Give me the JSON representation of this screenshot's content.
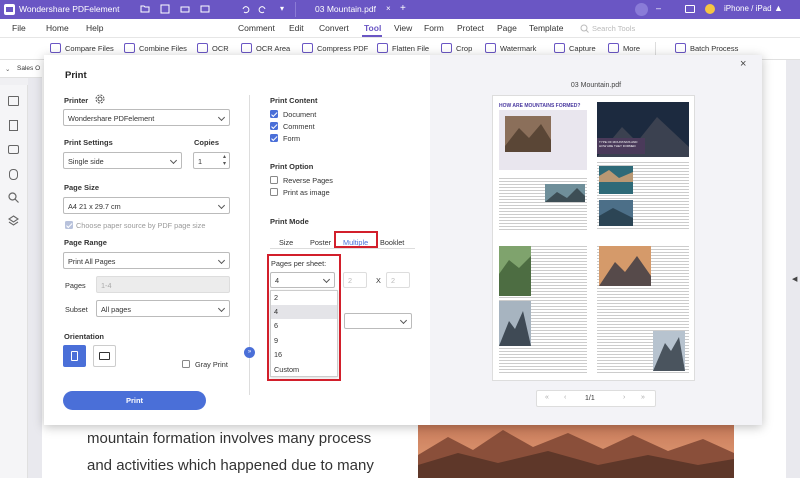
{
  "titlebar": {
    "app_name": "Wondershare PDFelement",
    "file_tab": "03 Mountain.pdf",
    "device_label": "iPhone / iPad"
  },
  "menubar": {
    "items": [
      "File",
      "Home",
      "Help",
      "Comment",
      "Edit",
      "Convert",
      "Tool",
      "View",
      "Form",
      "Protect",
      "Page",
      "Template"
    ],
    "active": "Tool",
    "search_placeholder": "Search Tools"
  },
  "toolbar": {
    "items": [
      "Compare Files",
      "Combine Files",
      "OCR",
      "OCR Area",
      "Compress PDF",
      "Flatten File",
      "Crop",
      "Watermark",
      "Capture",
      "More",
      "Batch Process"
    ]
  },
  "breadcrumb": "Sales O",
  "document": {
    "line1": "mountain formation involves many process",
    "line2": "and activities which happened due to many"
  },
  "dialog": {
    "title": "Print",
    "printer_label": "Printer",
    "printer_value": "Wondershare PDFelement",
    "print_settings_label": "Print Settings",
    "print_settings_value": "Single side",
    "copies_label": "Copies",
    "copies_value": "1",
    "page_size_label": "Page Size",
    "page_size_value": "A4 21 x 29.7 cm",
    "paper_source_label": "Choose paper source by PDF page size",
    "page_range_label": "Page Range",
    "page_range_value": "Print All Pages",
    "pages_label": "Pages",
    "pages_placeholder": "1-4",
    "subset_label": "Subset",
    "subset_value": "All pages",
    "orientation_label": "Orientation",
    "gray_print_label": "Gray Print",
    "print_button": "Print",
    "print_content_label": "Print Content",
    "content_items": [
      "Document",
      "Comment",
      "Form"
    ],
    "print_option_label": "Print Option",
    "option_items": [
      "Reverse Pages",
      "Print as image"
    ],
    "print_mode_label": "Print Mode",
    "mode_tabs": [
      "Size",
      "Poster",
      "Multiple",
      "Booklet"
    ],
    "active_mode": "Multiple",
    "pages_per_sheet_label": "Pages per sheet:",
    "pages_per_sheet_value": "4",
    "grid_cols": "2",
    "grid_x": "X",
    "grid_rows": "2",
    "pages_per_sheet_options": [
      "2",
      "4",
      "6",
      "9",
      "16",
      "Custom"
    ]
  },
  "preview": {
    "filename": "03 Mountain.pdf",
    "page_heading": "HOW ARE MOUNTAINS FORMED?",
    "card_heading": "TYPE OF MOUNTAINS AND HOW ARE THEY FORMED",
    "page_indicator": "1/1"
  },
  "colors": {
    "brand": "#6a56c4",
    "accent": "#4a6fd8",
    "highlight": "#d21f2b"
  }
}
